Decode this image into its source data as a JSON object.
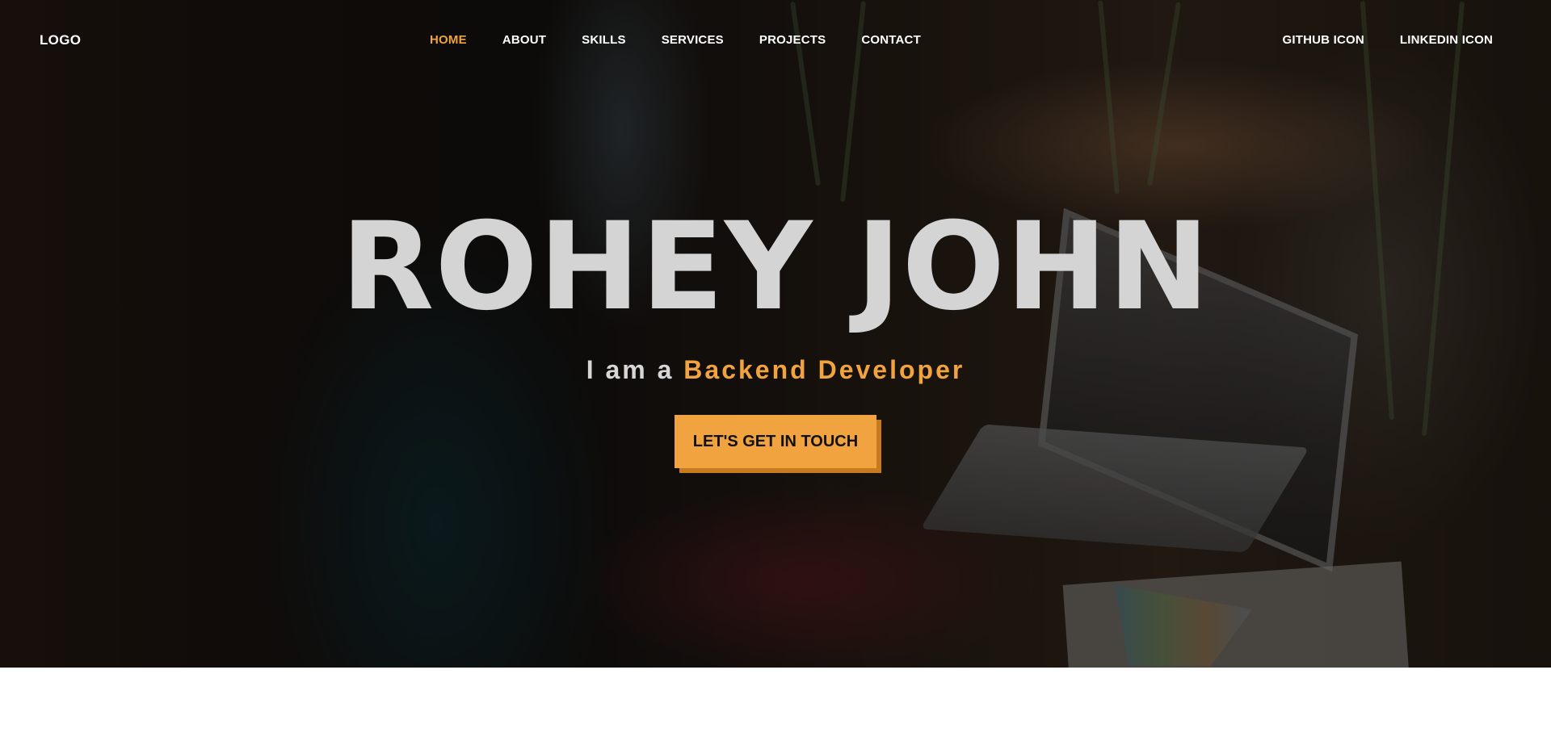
{
  "nav": {
    "logo": "LOGO",
    "menu": [
      {
        "label": "HOME",
        "active": true
      },
      {
        "label": "ABOUT",
        "active": false
      },
      {
        "label": "SKILLS",
        "active": false
      },
      {
        "label": "SERVICES",
        "active": false
      },
      {
        "label": "PROJECTS",
        "active": false
      },
      {
        "label": "CONTACT",
        "active": false
      }
    ],
    "social": [
      {
        "label": "GITHUB ICON"
      },
      {
        "label": "LINKEDIN ICON"
      }
    ]
  },
  "hero": {
    "title": "ROHEY JOHN",
    "subtitle_prefix": "I am a",
    "subtitle_role": "Backend Developer",
    "cta_label": "LET'S GET IN TOUCH"
  },
  "colors": {
    "accent": "#f0a33e",
    "text": "#ffffff",
    "title": "#d4d4d4"
  }
}
